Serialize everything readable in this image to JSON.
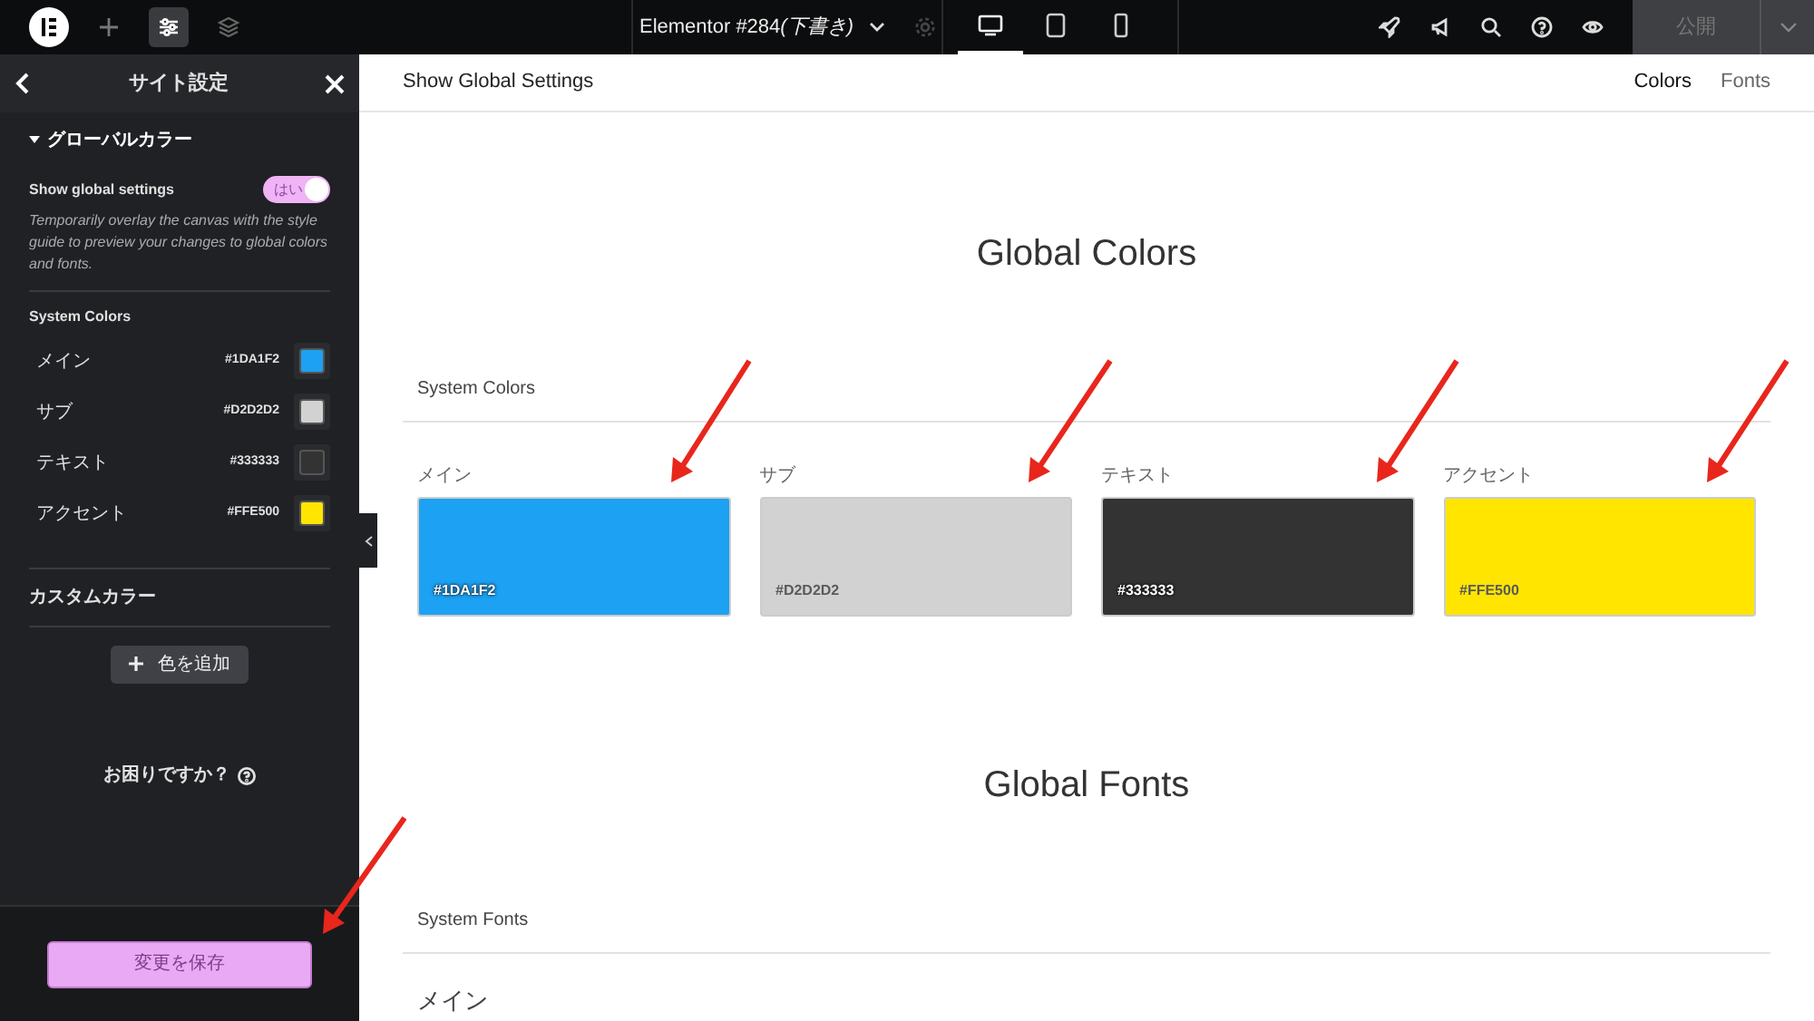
{
  "top_bar": {
    "document_title": "Elementor #284",
    "document_status": "(下書き)",
    "publish_button": "公開",
    "devices": [
      {
        "kind": "desktop",
        "selected": true
      },
      {
        "kind": "tablet",
        "selected": false
      },
      {
        "kind": "mobile",
        "selected": false
      }
    ]
  },
  "panel": {
    "title": "サイト設定",
    "section_title": "グローバルカラー",
    "section_expanded": true,
    "toggle": {
      "label": "Show global settings",
      "on": true,
      "on_text": "はい"
    },
    "description": "Temporarily overlay the canvas with the style guide to preview your changes to global colors and fonts.",
    "system_colors_heading": "System Colors",
    "system_colors": [
      {
        "name": "メイン",
        "hex": "#1DA1F2",
        "color": "#1da1f2"
      },
      {
        "name": "サブ",
        "hex": "#D2D2D2",
        "color": "#d2d2d2"
      },
      {
        "name": "テキスト",
        "hex": "#333333",
        "color": "#333333"
      },
      {
        "name": "アクセント",
        "hex": "#FFE500",
        "color": "#ffe500"
      }
    ],
    "custom_colors_heading": "カスタムカラー",
    "add_color_button": "色を追加",
    "help_link": "お困りですか？",
    "save_button": "変更を保存"
  },
  "canvas": {
    "header_title": "Show Global Settings",
    "nav": [
      {
        "label": "Colors",
        "selected": true
      },
      {
        "label": "Fonts",
        "selected": false
      }
    ],
    "colors_title": "Global Colors",
    "system_colors_heading": "System Colors",
    "swatches": [
      {
        "label": "メイン",
        "hex": "#1DA1F2",
        "color": "#1da1f2"
      },
      {
        "label": "サブ",
        "hex": "#D2D2D2",
        "color": "#d2d2d2"
      },
      {
        "label": "テキスト",
        "hex": "#333333",
        "color": "#333333"
      },
      {
        "label": "アクセント",
        "hex": "#FFE500",
        "color": "#ffe500"
      }
    ],
    "fonts_title": "Global Fonts",
    "system_fonts_heading": "System Fonts",
    "fonts": [
      {
        "label": "メイン"
      }
    ]
  }
}
